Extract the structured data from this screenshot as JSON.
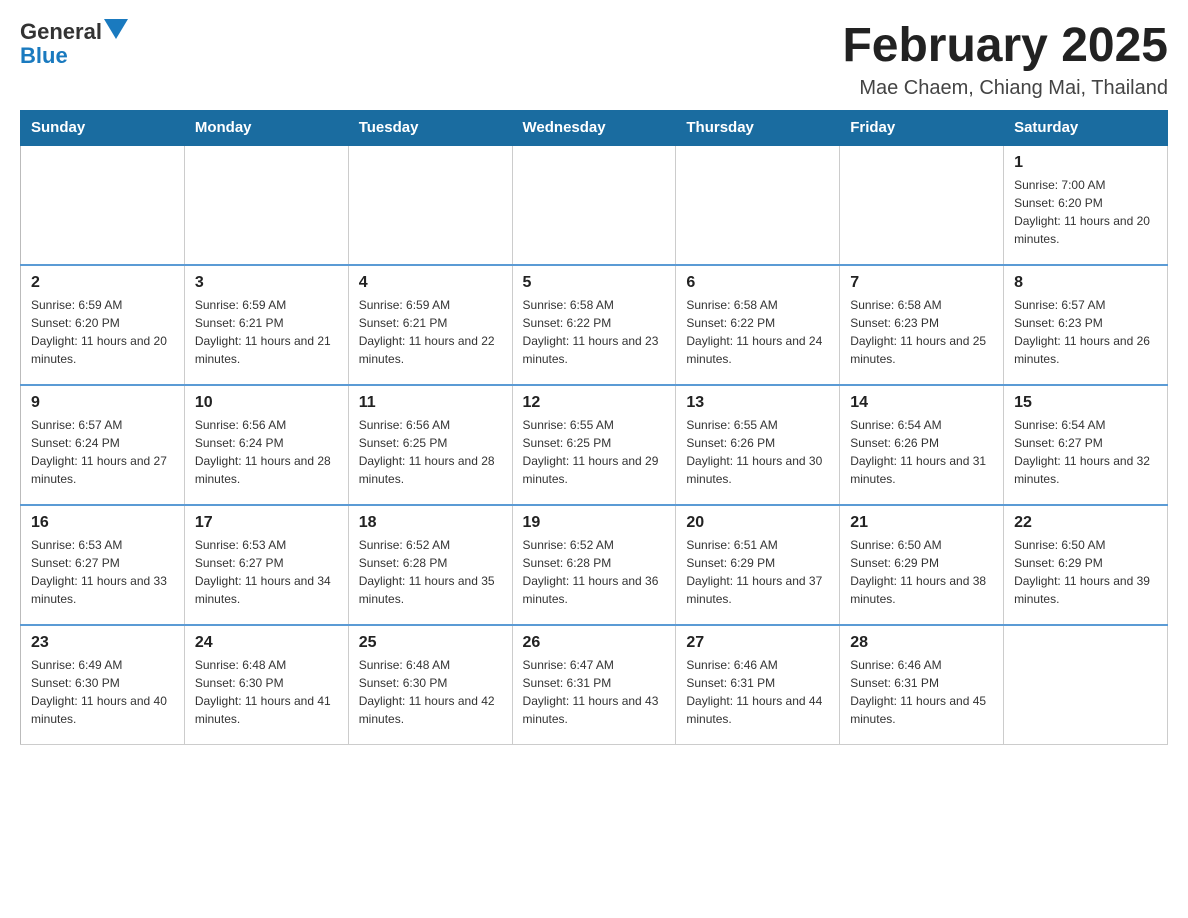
{
  "header": {
    "logo_general": "General",
    "logo_blue": "Blue",
    "title": "February 2025",
    "subtitle": "Mae Chaem, Chiang Mai, Thailand"
  },
  "days_of_week": [
    "Sunday",
    "Monday",
    "Tuesday",
    "Wednesday",
    "Thursday",
    "Friday",
    "Saturday"
  ],
  "weeks": [
    [
      {
        "day": "",
        "info": ""
      },
      {
        "day": "",
        "info": ""
      },
      {
        "day": "",
        "info": ""
      },
      {
        "day": "",
        "info": ""
      },
      {
        "day": "",
        "info": ""
      },
      {
        "day": "",
        "info": ""
      },
      {
        "day": "1",
        "info": "Sunrise: 7:00 AM\nSunset: 6:20 PM\nDaylight: 11 hours and 20 minutes."
      }
    ],
    [
      {
        "day": "2",
        "info": "Sunrise: 6:59 AM\nSunset: 6:20 PM\nDaylight: 11 hours and 20 minutes."
      },
      {
        "day": "3",
        "info": "Sunrise: 6:59 AM\nSunset: 6:21 PM\nDaylight: 11 hours and 21 minutes."
      },
      {
        "day": "4",
        "info": "Sunrise: 6:59 AM\nSunset: 6:21 PM\nDaylight: 11 hours and 22 minutes."
      },
      {
        "day": "5",
        "info": "Sunrise: 6:58 AM\nSunset: 6:22 PM\nDaylight: 11 hours and 23 minutes."
      },
      {
        "day": "6",
        "info": "Sunrise: 6:58 AM\nSunset: 6:22 PM\nDaylight: 11 hours and 24 minutes."
      },
      {
        "day": "7",
        "info": "Sunrise: 6:58 AM\nSunset: 6:23 PM\nDaylight: 11 hours and 25 minutes."
      },
      {
        "day": "8",
        "info": "Sunrise: 6:57 AM\nSunset: 6:23 PM\nDaylight: 11 hours and 26 minutes."
      }
    ],
    [
      {
        "day": "9",
        "info": "Sunrise: 6:57 AM\nSunset: 6:24 PM\nDaylight: 11 hours and 27 minutes."
      },
      {
        "day": "10",
        "info": "Sunrise: 6:56 AM\nSunset: 6:24 PM\nDaylight: 11 hours and 28 minutes."
      },
      {
        "day": "11",
        "info": "Sunrise: 6:56 AM\nSunset: 6:25 PM\nDaylight: 11 hours and 28 minutes."
      },
      {
        "day": "12",
        "info": "Sunrise: 6:55 AM\nSunset: 6:25 PM\nDaylight: 11 hours and 29 minutes."
      },
      {
        "day": "13",
        "info": "Sunrise: 6:55 AM\nSunset: 6:26 PM\nDaylight: 11 hours and 30 minutes."
      },
      {
        "day": "14",
        "info": "Sunrise: 6:54 AM\nSunset: 6:26 PM\nDaylight: 11 hours and 31 minutes."
      },
      {
        "day": "15",
        "info": "Sunrise: 6:54 AM\nSunset: 6:27 PM\nDaylight: 11 hours and 32 minutes."
      }
    ],
    [
      {
        "day": "16",
        "info": "Sunrise: 6:53 AM\nSunset: 6:27 PM\nDaylight: 11 hours and 33 minutes."
      },
      {
        "day": "17",
        "info": "Sunrise: 6:53 AM\nSunset: 6:27 PM\nDaylight: 11 hours and 34 minutes."
      },
      {
        "day": "18",
        "info": "Sunrise: 6:52 AM\nSunset: 6:28 PM\nDaylight: 11 hours and 35 minutes."
      },
      {
        "day": "19",
        "info": "Sunrise: 6:52 AM\nSunset: 6:28 PM\nDaylight: 11 hours and 36 minutes."
      },
      {
        "day": "20",
        "info": "Sunrise: 6:51 AM\nSunset: 6:29 PM\nDaylight: 11 hours and 37 minutes."
      },
      {
        "day": "21",
        "info": "Sunrise: 6:50 AM\nSunset: 6:29 PM\nDaylight: 11 hours and 38 minutes."
      },
      {
        "day": "22",
        "info": "Sunrise: 6:50 AM\nSunset: 6:29 PM\nDaylight: 11 hours and 39 minutes."
      }
    ],
    [
      {
        "day": "23",
        "info": "Sunrise: 6:49 AM\nSunset: 6:30 PM\nDaylight: 11 hours and 40 minutes."
      },
      {
        "day": "24",
        "info": "Sunrise: 6:48 AM\nSunset: 6:30 PM\nDaylight: 11 hours and 41 minutes."
      },
      {
        "day": "25",
        "info": "Sunrise: 6:48 AM\nSunset: 6:30 PM\nDaylight: 11 hours and 42 minutes."
      },
      {
        "day": "26",
        "info": "Sunrise: 6:47 AM\nSunset: 6:31 PM\nDaylight: 11 hours and 43 minutes."
      },
      {
        "day": "27",
        "info": "Sunrise: 6:46 AM\nSunset: 6:31 PM\nDaylight: 11 hours and 44 minutes."
      },
      {
        "day": "28",
        "info": "Sunrise: 6:46 AM\nSunset: 6:31 PM\nDaylight: 11 hours and 45 minutes."
      },
      {
        "day": "",
        "info": ""
      }
    ]
  ]
}
